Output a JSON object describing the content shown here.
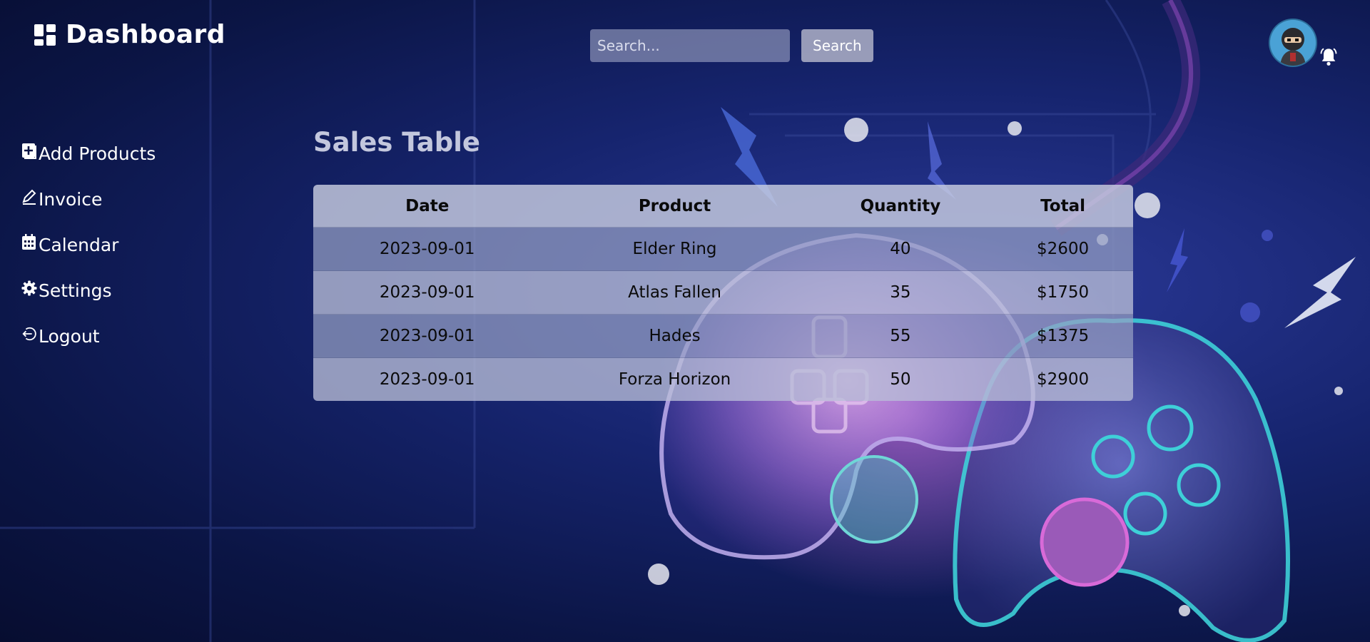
{
  "brand": {
    "title": "Dashboard",
    "icon": "grid-icon"
  },
  "search": {
    "placeholder": "Search...",
    "value": "",
    "button_label": "Search"
  },
  "user": {
    "avatar": "ninja-avatar",
    "notification_icon": "bell-icon"
  },
  "sidebar": {
    "items": [
      {
        "label": "Add Products",
        "icon": "add-box-icon"
      },
      {
        "label": "Invoice",
        "icon": "pencil-icon"
      },
      {
        "label": "Calendar",
        "icon": "calendar-icon"
      },
      {
        "label": "Settings",
        "icon": "gear-icon"
      },
      {
        "label": "Logout",
        "icon": "logout-icon"
      }
    ]
  },
  "main": {
    "title": "Sales Table",
    "table": {
      "columns": [
        "Date",
        "Product",
        "Quantity",
        "Total"
      ],
      "rows": [
        [
          "2023-09-01",
          "Elder Ring",
          "40",
          "$2600"
        ],
        [
          "2023-09-01",
          "Atlas Fallen",
          "35",
          "$1750"
        ],
        [
          "2023-09-01",
          "Hades",
          "55",
          "$1375"
        ],
        [
          "2023-09-01",
          "Forza Horizon",
          "50",
          "$2900"
        ]
      ]
    }
  },
  "colors": {
    "background": "#16246e",
    "title": "#c3c7dd",
    "accent_cyan": "#3ed0d8",
    "accent_pink": "#d86ad8"
  }
}
